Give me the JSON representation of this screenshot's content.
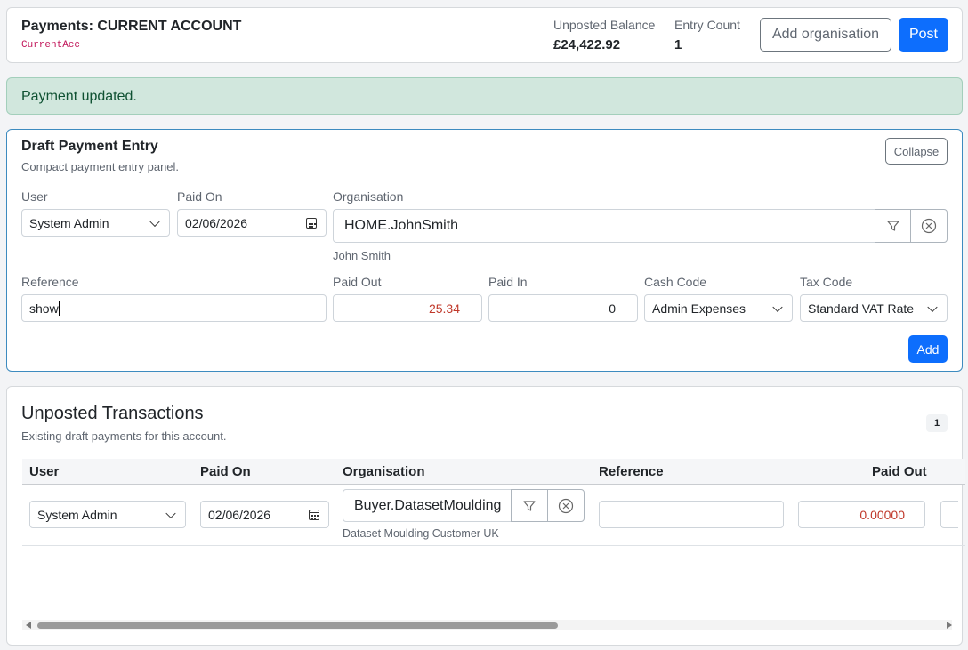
{
  "header": {
    "title": "Payments: CURRENT ACCOUNT",
    "code": "CurrentAcc",
    "unposted_label": "Unposted Balance",
    "unposted_value": "£24,422.92",
    "entry_label": "Entry Count",
    "entry_value": "1",
    "add_org_label": "Add organisation",
    "post_label": "Post"
  },
  "alert": {
    "message": "Payment updated."
  },
  "draft": {
    "title": "Draft Payment Entry",
    "subtitle": "Compact payment entry panel.",
    "collapse_label": "Collapse",
    "user_label": "User",
    "user_value": "System Admin",
    "paid_on_label": "Paid On",
    "paid_on_value": "02/06/2026",
    "organisation_label": "Organisation",
    "organisation_value": "HOME.JohnSmith",
    "organisation_name": "John Smith",
    "reference_label": "Reference",
    "reference_value": "show",
    "paid_out_label": "Paid Out",
    "paid_out_value": "25.34",
    "paid_in_label": "Paid In",
    "paid_in_value": "0",
    "cash_code_label": "Cash Code",
    "cash_code_value": "Admin Expenses",
    "tax_code_label": "Tax Code",
    "tax_code_value": "Standard VAT Rate",
    "add_label": "Add"
  },
  "unposted": {
    "title": "Unposted Transactions",
    "subtitle": "Existing draft payments for this account.",
    "count_badge": "1",
    "columns": [
      "User",
      "Paid On",
      "Organisation",
      "Reference",
      "Paid Out"
    ],
    "rows": [
      {
        "user": "System Admin",
        "paid_on": "02/06/2026",
        "organisation": "Buyer.DatasetMoulding",
        "organisation_name": "Dataset Moulding Customer UK",
        "reference": "",
        "paid_out": "0.00000"
      }
    ]
  },
  "icons": {
    "filter": "filter-icon",
    "clear": "clear-circle-icon",
    "calendar": "calendar-icon",
    "chevron": "chevron-down-icon"
  },
  "colors": {
    "primary": "#0d6efd",
    "alert_bg": "#d1e7dd",
    "alert_text": "#0f5132",
    "negative": "#c0392b",
    "code": "#c2185b"
  }
}
